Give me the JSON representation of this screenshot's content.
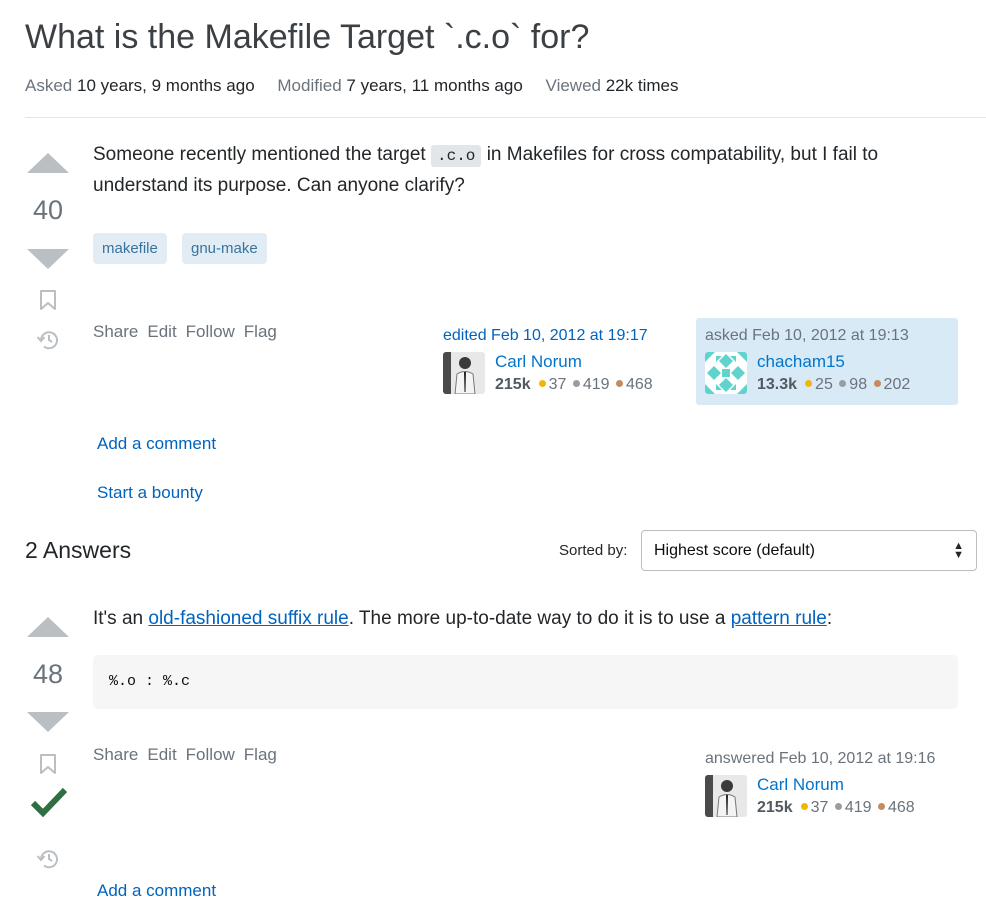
{
  "question": {
    "title": "What is the Makefile Target `.c.o` for?",
    "meta": {
      "asked_label": "Asked",
      "asked_value": "10 years, 9 months ago",
      "modified_label": "Modified",
      "modified_value": "7 years, 11 months ago",
      "viewed_label": "Viewed",
      "viewed_value": "22k times"
    },
    "score": "40",
    "body_before_code": "Someone recently mentioned the target",
    "body_code": ".c.o",
    "body_after_code": "in Makefiles for cross compatability, but I fail to understand its purpose. Can anyone clarify?",
    "tags": [
      "makefile",
      "gnu-make"
    ],
    "menu": {
      "share": "Share",
      "edit": "Edit",
      "follow": "Follow",
      "flag": "Flag"
    },
    "edited": {
      "action": "edited Feb 10, 2012 at 19:17",
      "user": "Carl Norum",
      "rep": "215k",
      "gold": "37",
      "silver": "419",
      "bronze": "468"
    },
    "asked_by": {
      "action": "asked Feb 10, 2012 at 19:13",
      "user": "chacham15",
      "rep": "13.3k",
      "gold": "25",
      "silver": "98",
      "bronze": "202"
    },
    "add_comment": "Add a comment",
    "start_bounty": "Start a bounty"
  },
  "answers_section": {
    "header": "2 Answers",
    "sorted_label": "Sorted by:",
    "sort_selected": "Highest score (default)"
  },
  "answer": {
    "score": "48",
    "text_1": "It's an",
    "link_1": "old-fashioned suffix rule",
    "text_2": ". The more up-to-date way to do it is to use a",
    "link_2": "pattern rule",
    "text_3": ":",
    "code": "%.o : %.c",
    "menu": {
      "share": "Share",
      "edit": "Edit",
      "follow": "Follow",
      "flag": "Flag"
    },
    "answered": {
      "action": "answered Feb 10, 2012 at 19:16",
      "user": "Carl Norum",
      "rep": "215k",
      "gold": "37",
      "silver": "419",
      "bronze": "468"
    },
    "add_comment": "Add a comment"
  },
  "colors": {
    "link": "#0063bf",
    "accept": "#2f6f44",
    "tag_bg": "#e1ecf4",
    "tag_text": "#39739d",
    "asked_bg": "#d9eaf7"
  },
  "icons": [
    "bookmark-icon",
    "history-icon",
    "accepted-check-icon",
    "sort-arrows-icon"
  ]
}
